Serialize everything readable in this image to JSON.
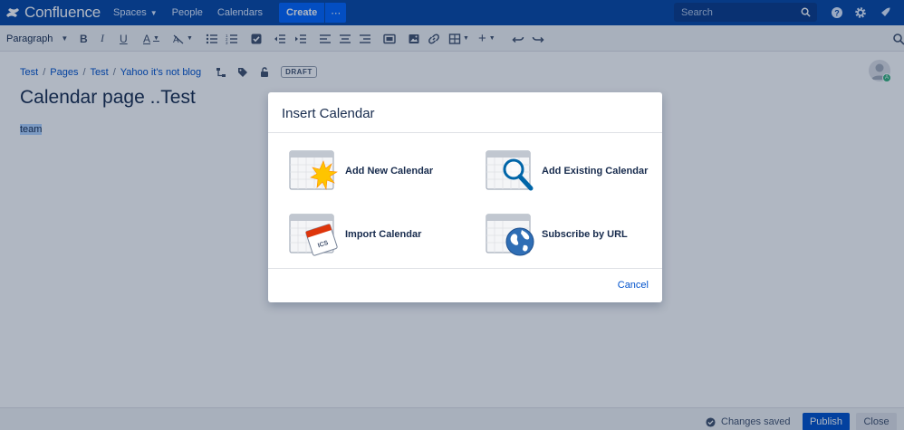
{
  "app": {
    "logo_text": "Confluence",
    "brand_color": "#0747a6"
  },
  "topnav": {
    "spaces": "Spaces",
    "people": "People",
    "calendars": "Calendars",
    "create": "Create",
    "more": "⋯",
    "search_placeholder": "Search",
    "icons": [
      "help-icon",
      "settings-icon",
      "notifications-icon"
    ]
  },
  "toolbar": {
    "paragraph": "Paragraph"
  },
  "page": {
    "breadcrumb": [
      "Test",
      "Pages",
      "Test",
      "Yahoo it's not blog"
    ],
    "breadcrumb_sep": "/",
    "status": "DRAFT",
    "title": "Calendar page ..Test",
    "body": "team",
    "avatar_badge": "A"
  },
  "dialog": {
    "title": "Insert Calendar",
    "options": [
      {
        "label": "Add New Calendar",
        "icon": "new-calendar-icon"
      },
      {
        "label": "Add Existing Calendar",
        "icon": "existing-calendar-icon"
      },
      {
        "label": "Import Calendar",
        "icon": "import-calendar-icon"
      },
      {
        "label": "Subscribe by URL",
        "icon": "subscribe-url-icon"
      }
    ],
    "cancel": "Cancel"
  },
  "bottombar": {
    "status": "Changes saved",
    "publish": "Publish",
    "close": "Close"
  }
}
